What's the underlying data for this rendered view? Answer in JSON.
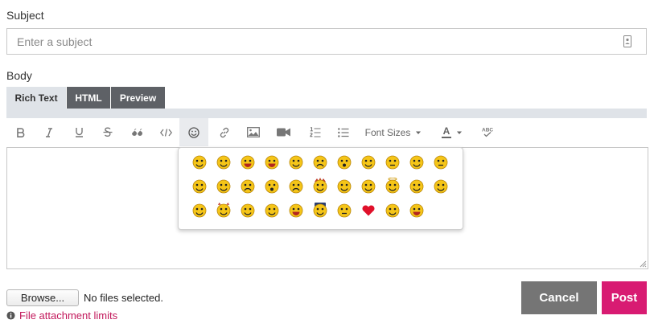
{
  "subject": {
    "label": "Subject",
    "placeholder": "Enter a subject"
  },
  "body": {
    "label": "Body"
  },
  "tabs": [
    {
      "label": "Rich Text",
      "active": true
    },
    {
      "label": "HTML",
      "active": false
    },
    {
      "label": "Preview",
      "active": false
    }
  ],
  "toolbar": {
    "buttons": [
      "bold-icon",
      "italic-icon",
      "underline-icon",
      "strikethrough-icon",
      "quote-icon",
      "code-icon",
      "smiley-icon",
      "link-icon",
      "image-icon",
      "video-icon",
      "ordered-list-icon",
      "bullet-list-icon"
    ],
    "font_sizes_label": "Font Sizes",
    "font_color_label": "A",
    "spellcheck_icon": "spellcheck-icon",
    "active_button": "smiley-icon"
  },
  "emoji_panel": {
    "rows": [
      [
        "smile",
        "wink",
        "grin",
        "laugh",
        "angry",
        "sad",
        "surprised",
        "cool",
        "thinking",
        "confused",
        "neutral"
      ],
      [
        "blush",
        "pouting",
        "worried",
        "shocked",
        "crying",
        "crazy",
        "tongue",
        "thumbs-up",
        "angel",
        "relieved",
        "dizzy"
      ],
      [
        "sunglasses",
        "devil",
        "pointing",
        "sleeping",
        "big-grin",
        "police",
        "whistle",
        "heart",
        "nerd",
        "cheering"
      ]
    ]
  },
  "attachments": {
    "browse_label": "Browse...",
    "status": "No files selected.",
    "limits_link": "File attachment limits"
  },
  "actions": {
    "cancel_label": "Cancel",
    "post_label": "Post"
  },
  "colors": {
    "accent": "#d81b72",
    "cancel": "#757575",
    "tab_dark": "#5e6166",
    "tab_light": "#dfe3e8",
    "emoji_yellow": "#f5c518"
  }
}
